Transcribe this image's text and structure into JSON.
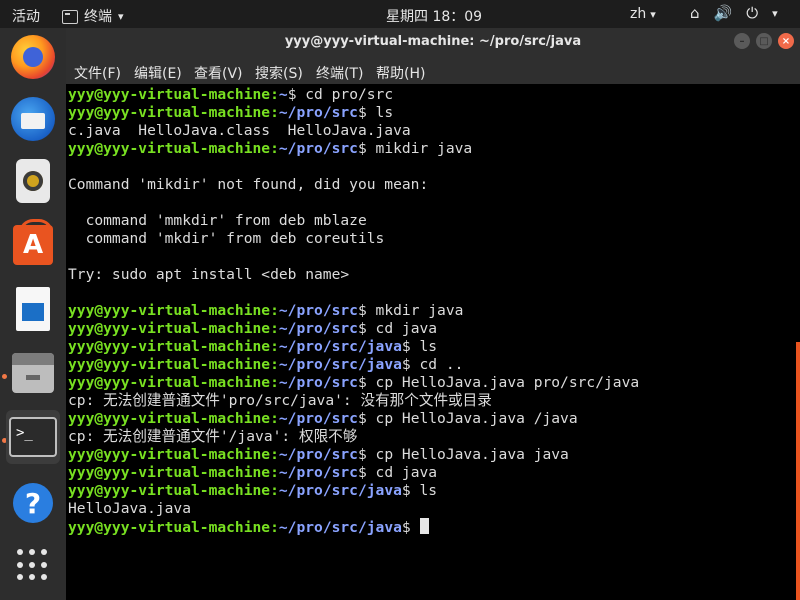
{
  "topbar": {
    "activities": "活动",
    "app_menu": "终端",
    "clock": "星期四 18：09",
    "lang": "zh",
    "icons": [
      "network-icon",
      "volume-icon",
      "power-icon"
    ]
  },
  "dock": {
    "items": [
      {
        "name": "firefox",
        "icon": "firefox-icon"
      },
      {
        "name": "thunderbird",
        "icon": "thunderbird-icon"
      },
      {
        "name": "rhythmbox",
        "icon": "rhythmbox-icon"
      },
      {
        "name": "software",
        "icon": "software-center-icon"
      },
      {
        "name": "writer",
        "icon": "libreoffice-writer-icon"
      },
      {
        "name": "files",
        "icon": "files-icon"
      },
      {
        "name": "terminal",
        "icon": "terminal-icon"
      },
      {
        "name": "help",
        "icon": "help-icon"
      },
      {
        "name": "app-grid",
        "icon": "app-grid-icon"
      }
    ]
  },
  "window": {
    "title": "yyy@yyy-virtual-machine: ~/pro/src/java",
    "menu": [
      "文件(F)",
      "编辑(E)",
      "查看(V)",
      "搜索(S)",
      "终端(T)",
      "帮助(H)"
    ]
  },
  "terminal": {
    "lines": [
      {
        "user": "yyy@yyy-virtual-machine",
        "path": "~",
        "cmd": " cd pro/src"
      },
      {
        "user": "yyy@yyy-virtual-machine",
        "path": "~/pro/src",
        "cmd": " ls"
      },
      {
        "text": "c.java  HelloJava.class  HelloJava.java"
      },
      {
        "user": "yyy@yyy-virtual-machine",
        "path": "~/pro/src",
        "cmd": " mikdir java"
      },
      {
        "text": ""
      },
      {
        "text": "Command 'mikdir' not found, did you mean:"
      },
      {
        "text": ""
      },
      {
        "text": "  command 'mmkdir' from deb mblaze"
      },
      {
        "text": "  command 'mkdir' from deb coreutils"
      },
      {
        "text": ""
      },
      {
        "text": "Try: sudo apt install <deb name>"
      },
      {
        "text": ""
      },
      {
        "user": "yyy@yyy-virtual-machine",
        "path": "~/pro/src",
        "cmd": " mkdir java"
      },
      {
        "user": "yyy@yyy-virtual-machine",
        "path": "~/pro/src",
        "cmd": " cd java"
      },
      {
        "user": "yyy@yyy-virtual-machine",
        "path": "~/pro/src/java",
        "cmd": " ls"
      },
      {
        "user": "yyy@yyy-virtual-machine",
        "path": "~/pro/src/java",
        "cmd": " cd .."
      },
      {
        "user": "yyy@yyy-virtual-machine",
        "path": "~/pro/src",
        "cmd": " cp HelloJava.java pro/src/java"
      },
      {
        "text": "cp: 无法创建普通文件'pro/src/java': 没有那个文件或目录"
      },
      {
        "user": "yyy@yyy-virtual-machine",
        "path": "~/pro/src",
        "cmd": " cp HelloJava.java /java"
      },
      {
        "text": "cp: 无法创建普通文件'/java': 权限不够"
      },
      {
        "user": "yyy@yyy-virtual-machine",
        "path": "~/pro/src",
        "cmd": " cp HelloJava.java java"
      },
      {
        "user": "yyy@yyy-virtual-machine",
        "path": "~/pro/src",
        "cmd": " cd java"
      },
      {
        "user": "yyy@yyy-virtual-machine",
        "path": "~/pro/src/java",
        "cmd": " ls"
      },
      {
        "text": "HelloJava.java"
      },
      {
        "user": "yyy@yyy-virtual-machine",
        "path": "~/pro/src/java",
        "cmd": " ",
        "cursor": true
      }
    ]
  },
  "colors": {
    "user": "#78e021",
    "path": "#8aa3ff",
    "accent": "#e95420"
  }
}
